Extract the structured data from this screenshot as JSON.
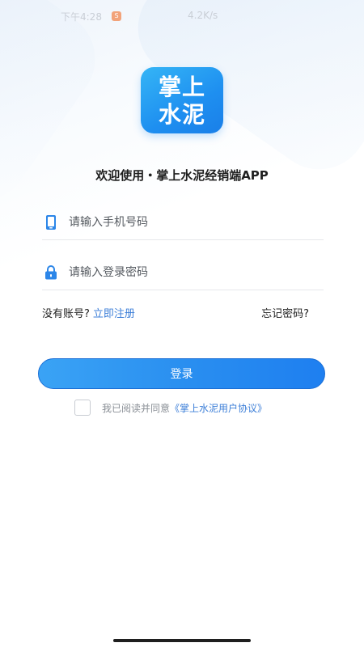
{
  "status_bar": {
    "time_left": "下午4:28",
    "badge": "S",
    "time_right": "4.2K/s"
  },
  "logo": {
    "line1": "掌上",
    "line2": "水泥"
  },
  "welcome_text": "欢迎使用・掌上水泥经销端APP",
  "login_form": {
    "phone_placeholder": "请输入手机号码",
    "password_placeholder": "请输入登录密码",
    "no_account_text": "没有账号?",
    "register_link": "立即注册",
    "forgot_password": "忘记密码?",
    "login_button": "登录"
  },
  "agreement": {
    "prefix": "我已阅读并同意",
    "link": "《掌上水泥用户协议》"
  },
  "colors": {
    "accent": "#2a8ff0",
    "link": "#3d7fd8"
  },
  "icons": {
    "phone": "phone-icon",
    "lock": "lock-icon"
  }
}
